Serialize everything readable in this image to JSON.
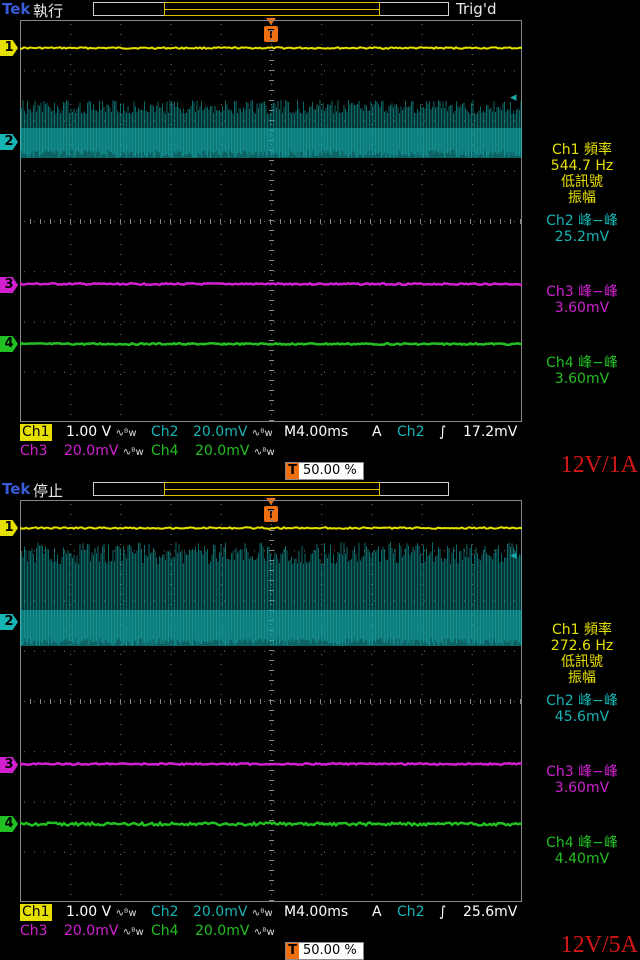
{
  "colors": {
    "ch1": "#e6e000",
    "ch2": "#18b4b4",
    "ch3": "#d020d0",
    "ch4": "#22c022",
    "trigger": "#f07010",
    "label_red": "#d01818"
  },
  "panels": [
    {
      "tek": "Tek",
      "status": "執行",
      "trig_state": "Trig'd",
      "trigger_marker": "T",
      "channel_markers": [
        "1",
        "2",
        "3",
        "4"
      ],
      "ch2_amplitude": "low",
      "side": {
        "ch1_title": "Ch1 頻率",
        "ch1_value": "544.7 Hz",
        "ch1_note1": "低訊號",
        "ch1_note2": "振幅",
        "ch2_title": "Ch2 峰−峰",
        "ch2_value": "25.2mV",
        "ch3_title": "Ch3 峰−峰",
        "ch3_value": "3.60mV",
        "ch4_title": "Ch4 峰−峰",
        "ch4_value": "3.60mV"
      },
      "bottom": {
        "ch1_label": "Ch1",
        "ch1_scale": "1.00 V",
        "ch2_label": "Ch2",
        "ch2_scale": "20.0mV",
        "timebase": "M4.00ms",
        "trig_mode": "A",
        "trig_ch": "Ch2",
        "trig_slope": "∫",
        "trig_level": "17.2mV",
        "ch3_label": "Ch3",
        "ch3_scale": "20.0mV",
        "ch4_label": "Ch4",
        "ch4_scale": "20.0mV",
        "trig_pos": "50.00 %",
        "bw_symbol": "∿ᴮw"
      },
      "condition": "12V/1A"
    },
    {
      "tek": "Tek",
      "status": "停止",
      "trig_state": "",
      "trigger_marker": "T",
      "channel_markers": [
        "1",
        "2",
        "3",
        "4"
      ],
      "ch2_amplitude": "high",
      "side": {
        "ch1_title": "Ch1 頻率",
        "ch1_value": "272.6 Hz",
        "ch1_note1": "低訊號",
        "ch1_note2": "振幅",
        "ch2_title": "Ch2 峰−峰",
        "ch2_value": "45.6mV",
        "ch3_title": "Ch3 峰−峰",
        "ch3_value": "3.60mV",
        "ch4_title": "Ch4 峰−峰",
        "ch4_value": "4.40mV"
      },
      "bottom": {
        "ch1_label": "Ch1",
        "ch1_scale": "1.00 V",
        "ch2_label": "Ch2",
        "ch2_scale": "20.0mV",
        "timebase": "M4.00ms",
        "trig_mode": "A",
        "trig_ch": "Ch2",
        "trig_slope": "∫",
        "trig_level": "25.6mV",
        "ch3_label": "Ch3",
        "ch3_scale": "20.0mV",
        "ch4_label": "Ch4",
        "ch4_scale": "20.0mV",
        "trig_pos": "50.00 %",
        "bw_symbol": "∿ᴮw"
      },
      "condition": "12V/5A"
    }
  ]
}
